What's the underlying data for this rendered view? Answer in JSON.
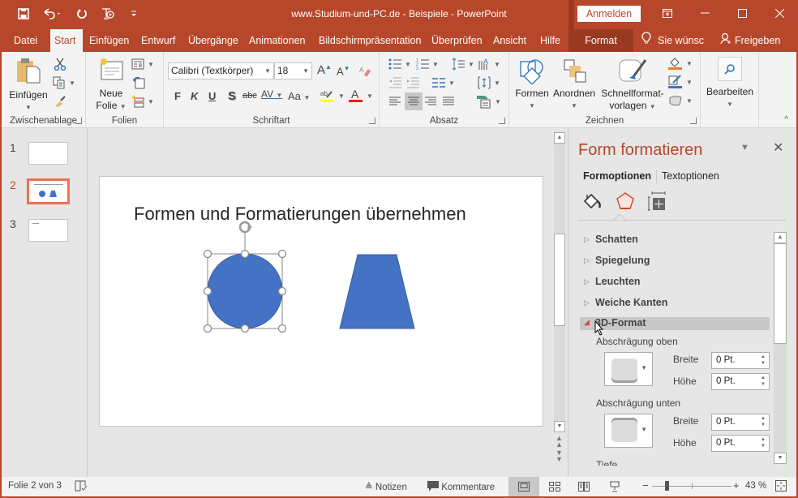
{
  "window": {
    "title": "www.Studium-und-PC.de - Beispiele - PowerPoint",
    "signin_label": "Anmelden",
    "accent_color": "#b7472a"
  },
  "qat": {
    "icons": [
      "save-icon",
      "undo-icon",
      "redo-icon",
      "start-presentation-icon",
      "customize-qat-icon"
    ]
  },
  "tabs": [
    {
      "label": "Datei"
    },
    {
      "label": "Start",
      "active": true
    },
    {
      "label": "Einfügen"
    },
    {
      "label": "Entwurf"
    },
    {
      "label": "Übergänge"
    },
    {
      "label": "Animationen"
    },
    {
      "label": "Bildschirmpräsentation"
    },
    {
      "label": "Überprüfen"
    },
    {
      "label": "Ansicht"
    },
    {
      "label": "Hilfe"
    },
    {
      "label": "Format",
      "contextual": true
    }
  ],
  "tellme": {
    "label": "Sie wünsc"
  },
  "share": {
    "label": "Freigeben"
  },
  "ribbon": {
    "clipboard": {
      "label": "Zwischenablage",
      "paste": "Einfügen"
    },
    "slides": {
      "label": "Folien",
      "new_slide_line1": "Neue",
      "new_slide_line2": "Folie"
    },
    "font": {
      "label": "Schriftart",
      "font_name": "Calibri (Textkörper)",
      "font_size": "18",
      "bold": "F",
      "italic": "K",
      "underline": "U",
      "shadow": "S",
      "strike": "abc",
      "spacing": "AV",
      "case": "Aa",
      "grow": "A",
      "shrink": "A",
      "highlight_color": "#ffff00",
      "font_color": "#ff0000"
    },
    "paragraph": {
      "label": "Absatz"
    },
    "drawing": {
      "label": "Zeichnen",
      "shapes": "Formen",
      "arrange": "Anordnen",
      "quickstyles_line1": "Schnellformat-",
      "quickstyles_line2": "vorlagen",
      "fill_color": "#ed7d31",
      "outline_color": "#4472c4"
    },
    "editing": {
      "label": "Bearbeiten"
    }
  },
  "thumbnails": [
    {
      "number": "1"
    },
    {
      "number": "2",
      "selected": true
    },
    {
      "number": "3"
    }
  ],
  "slide": {
    "title": "Formen und Formatierungen übernehmen",
    "shape_color": "#4472c4"
  },
  "format_pane": {
    "title": "Form formatieren",
    "tabs": [
      {
        "label": "Formoptionen",
        "active": true
      },
      {
        "label": "Textoptionen"
      }
    ],
    "icons": [
      "fill-line-icon",
      "effects-icon",
      "size-properties-icon"
    ],
    "sections": [
      {
        "label": "Schatten",
        "expanded": false
      },
      {
        "label": "Spiegelung",
        "expanded": false
      },
      {
        "label": "Leuchten",
        "expanded": false
      },
      {
        "label": "Weiche Kanten",
        "expanded": false
      },
      {
        "label": "3D-Format",
        "expanded": true
      }
    ],
    "bevel_top": {
      "label": "Abschrägung oben",
      "width_label": "Breite",
      "width_value": "0 Pt.",
      "height_label": "Höhe",
      "height_value": "0 Pt."
    },
    "bevel_bottom": {
      "label": "Abschrägung unten",
      "width_label": "Breite",
      "width_value": "0 Pt.",
      "height_label": "Höhe",
      "height_value": "0 Pt."
    },
    "depth_label": "Tiefe"
  },
  "status": {
    "slide_info": "Folie 2 von 3",
    "notes": "Notizen",
    "comments": "Kommentare",
    "zoom": "43 %",
    "zoom_level_percent": 43
  }
}
